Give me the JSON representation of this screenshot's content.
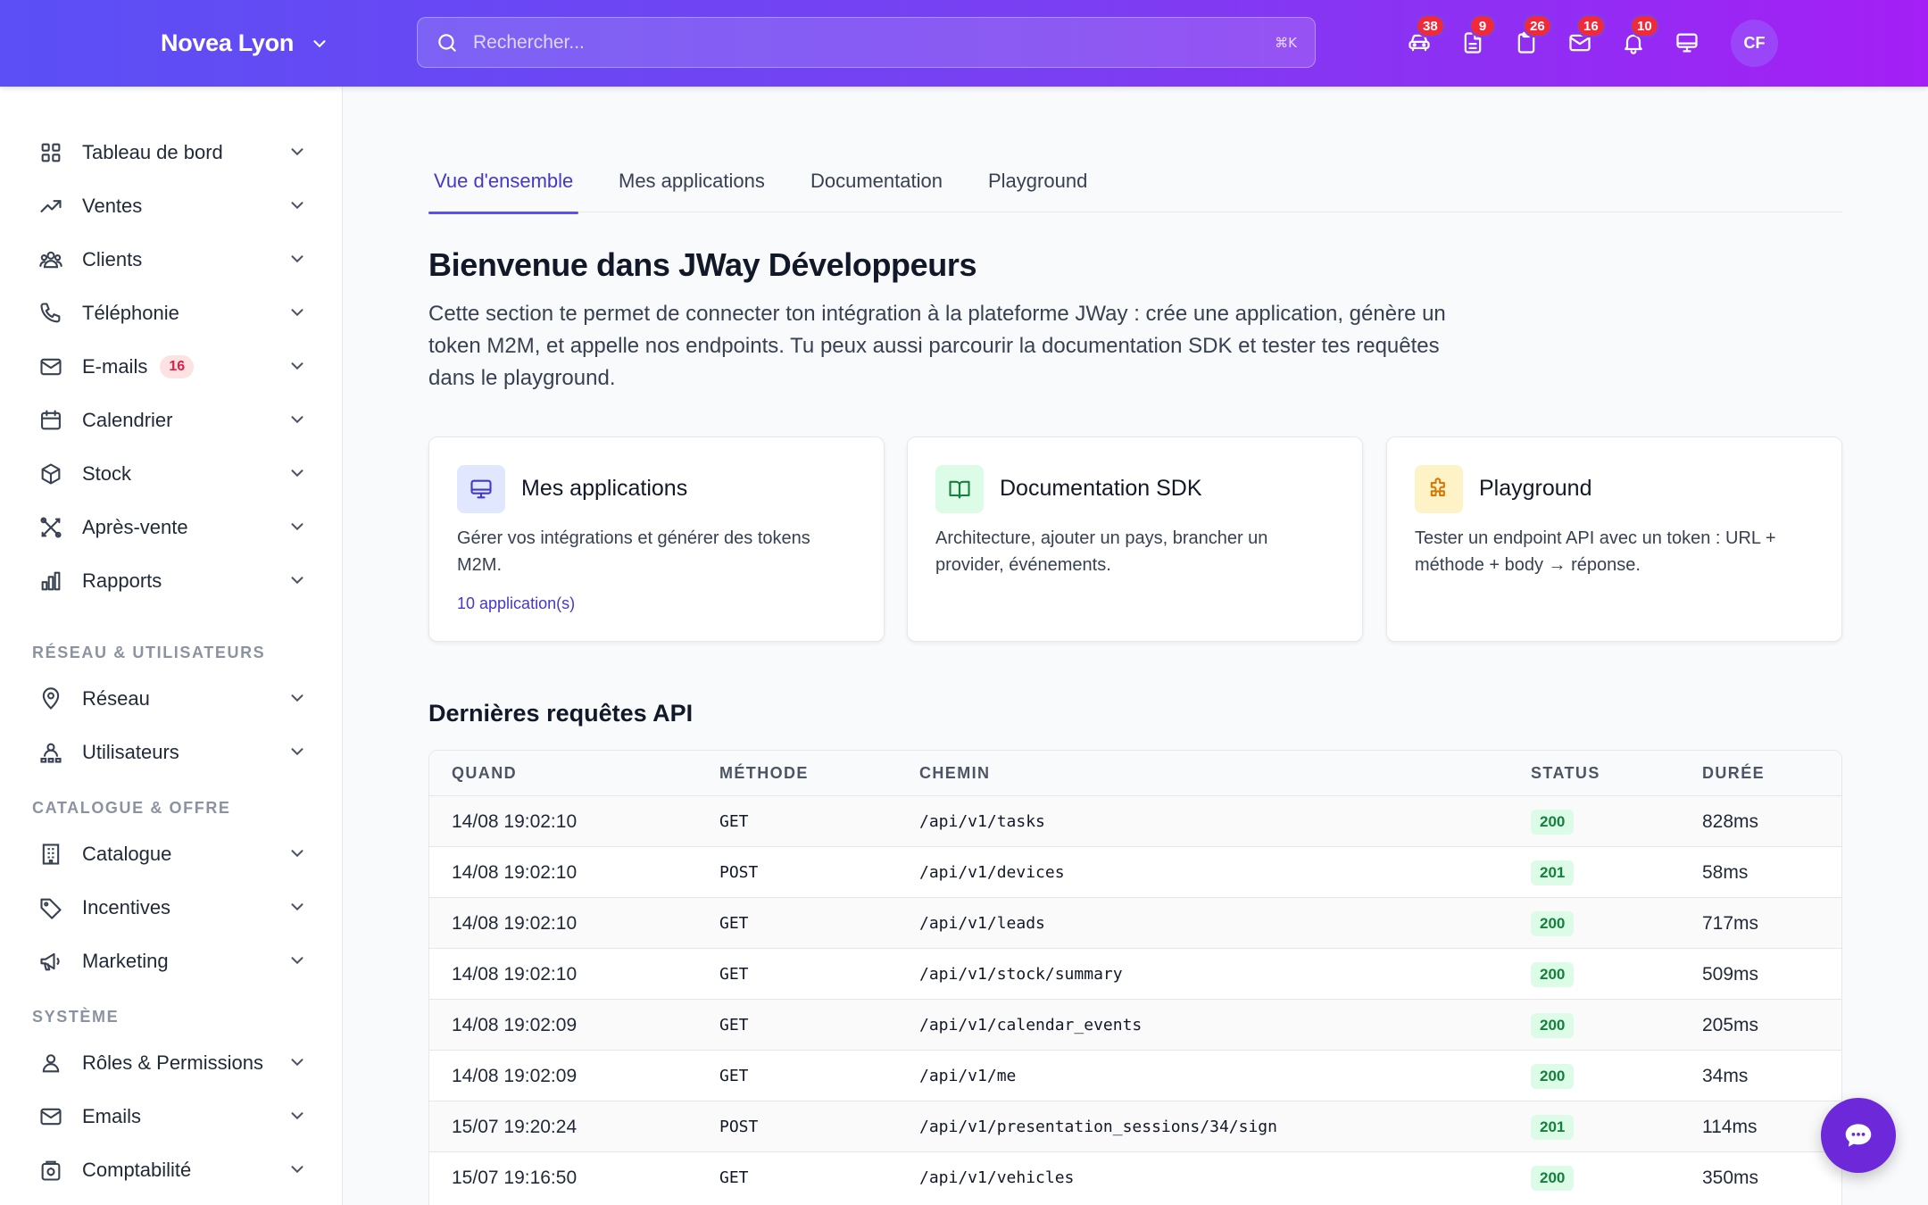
{
  "header": {
    "brand": "Novea Lyon",
    "search_placeholder": "Rechercher...",
    "search_shortcut": "⌘K",
    "icons": [
      {
        "name": "car-icon",
        "badge": "38"
      },
      {
        "name": "document-icon",
        "badge": "9"
      },
      {
        "name": "clipboard-icon",
        "badge": "26"
      },
      {
        "name": "mail-icon",
        "badge": "16"
      },
      {
        "name": "bell-icon",
        "badge": "10"
      },
      {
        "name": "monitor-icon",
        "badge": ""
      }
    ],
    "avatar": "CF"
  },
  "sidebar": {
    "items": [
      {
        "label": "Tableau de bord",
        "icon": "grid-icon"
      },
      {
        "label": "Ventes",
        "icon": "trend-icon"
      },
      {
        "label": "Clients",
        "icon": "users-icon"
      },
      {
        "label": "Téléphonie",
        "icon": "phone-icon"
      },
      {
        "label": "E-mails",
        "icon": "mail-icon",
        "badge": "16"
      },
      {
        "label": "Calendrier",
        "icon": "calendar-icon"
      },
      {
        "label": "Stock",
        "icon": "box-icon"
      },
      {
        "label": "Après-vente",
        "icon": "tools-icon"
      },
      {
        "label": "Rapports",
        "icon": "chart-icon"
      }
    ],
    "section_network": "RÉSEAU & UTILISATEURS",
    "network_items": [
      {
        "label": "Réseau",
        "icon": "location-icon"
      },
      {
        "label": "Utilisateurs",
        "icon": "user-network-icon"
      }
    ],
    "section_catalog": "CATALOGUE & OFFRE",
    "catalog_items": [
      {
        "label": "Catalogue",
        "icon": "building-icon"
      },
      {
        "label": "Incentives",
        "icon": "tag-icon"
      },
      {
        "label": "Marketing",
        "icon": "megaphone-icon"
      }
    ],
    "section_system": "SYSTÈME",
    "system_items": [
      {
        "label": "Rôles & Permissions",
        "icon": "user-icon"
      },
      {
        "label": "Emails",
        "icon": "mail-icon"
      },
      {
        "label": "Comptabilité",
        "icon": "safe-icon"
      }
    ]
  },
  "tabs": [
    "Vue d'ensemble",
    "Mes applications",
    "Documentation",
    "Playground"
  ],
  "main": {
    "title": "Bienvenue dans JWay Développeurs",
    "intro": "Cette section te permet de connecter ton intégration à la plateforme JWay : crée une application, génère un token M2M, et appelle nos endpoints. Tu peux aussi parcourir la documentation SDK et tester tes requêtes dans le playground."
  },
  "cards": [
    {
      "title": "Mes applications",
      "desc": "Gérer vos intégrations et générer des tokens M2M.",
      "link": "10 application(s)",
      "accent": "#e0e7ff",
      "icon": "monitor-icon"
    },
    {
      "title": "Documentation SDK",
      "desc": "Architecture, ajouter un pays, brancher un provider, événements.",
      "link": "",
      "accent": "#dcfce7",
      "icon": "book-icon"
    },
    {
      "title": "Playground",
      "desc": "Tester un endpoint API avec un token : URL + méthode + body → réponse.",
      "link": "",
      "accent": "#fef3c7",
      "icon": "puzzle-icon"
    }
  ],
  "requests": {
    "title": "Dernières requêtes API",
    "columns": [
      "QUAND",
      "MÉTHODE",
      "CHEMIN",
      "STATUS",
      "DURÉE"
    ],
    "rows": [
      {
        "when": "14/08 19:02:10",
        "method": "GET",
        "path": "/api/v1/tasks",
        "status": "200",
        "duration": "828ms"
      },
      {
        "when": "14/08 19:02:10",
        "method": "POST",
        "path": "/api/v1/devices",
        "status": "201",
        "duration": "58ms"
      },
      {
        "when": "14/08 19:02:10",
        "method": "GET",
        "path": "/api/v1/leads",
        "status": "200",
        "duration": "717ms"
      },
      {
        "when": "14/08 19:02:10",
        "method": "GET",
        "path": "/api/v1/stock/summary",
        "status": "200",
        "duration": "509ms"
      },
      {
        "when": "14/08 19:02:09",
        "method": "GET",
        "path": "/api/v1/calendar_events",
        "status": "200",
        "duration": "205ms"
      },
      {
        "when": "14/08 19:02:09",
        "method": "GET",
        "path": "/api/v1/me",
        "status": "200",
        "duration": "34ms"
      },
      {
        "when": "15/07 19:20:24",
        "method": "POST",
        "path": "/api/v1/presentation_sessions/34/sign",
        "status": "201",
        "duration": "114ms"
      },
      {
        "when": "15/07 19:16:50",
        "method": "GET",
        "path": "/api/v1/vehicles",
        "status": "200",
        "duration": "350ms"
      }
    ]
  },
  "colors": {
    "primary": "#5b4ff5",
    "accent": "#a41ff5",
    "badge": "#ef2b3b",
    "success": "#15803d"
  }
}
